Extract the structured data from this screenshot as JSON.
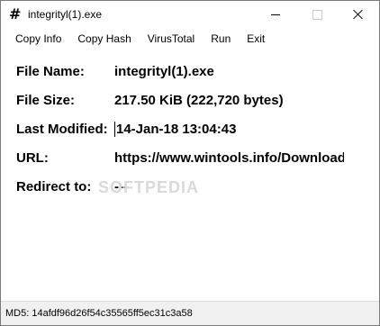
{
  "window": {
    "title": "integrityl(1).exe",
    "app_icon": "#"
  },
  "menu": {
    "items": [
      "Copy Info",
      "Copy Hash",
      "VirusTotal",
      "Run",
      "Exit"
    ]
  },
  "fields": [
    {
      "label": "File Name:",
      "value": "integrityl(1).exe"
    },
    {
      "label": "File Size:",
      "value": "217.50 KiB (222,720 bytes)"
    },
    {
      "label": "Last Modified:",
      "value": "14-Jan-18 13:04:43"
    },
    {
      "label": "URL:",
      "value": "https://www.wintools.info/Download"
    },
    {
      "label": "Redirect to:",
      "value": "---"
    }
  ],
  "watermark": "SOFTPEDIA",
  "status": {
    "md5": "MD5: 14afdf96d26f54c35565ff5ec31c3a58"
  }
}
